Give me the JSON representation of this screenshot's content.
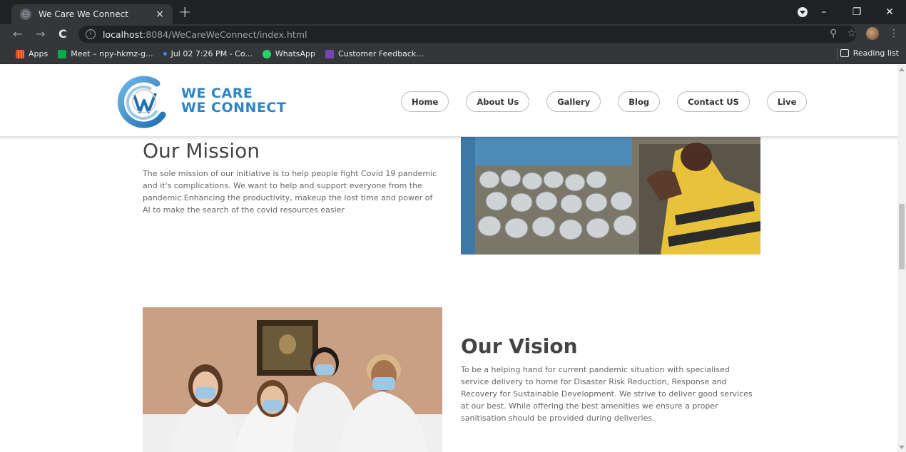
{
  "browser": {
    "tab_title": "We Care We Connect",
    "tab_close": "×",
    "new_tab": "+",
    "url_host": "localhost",
    "url_rest": ":8084/WeCareWeConnect/index.html",
    "window_min": "–",
    "window_restore": "❐",
    "window_close": "✕"
  },
  "bookmarks": [
    {
      "label": "Apps",
      "icon": "apps-grid-icon",
      "color": "#4285f4"
    },
    {
      "label": "Meet – npy-hkmz-g...",
      "icon": "meet-icon",
      "color": "#00ac47"
    },
    {
      "label": "Jul 02 7:26 PM - Co...",
      "icon": "dot-icon",
      "color": "#4285f4"
    },
    {
      "label": "WhatsApp",
      "icon": "whatsapp-icon",
      "color": "#25d366"
    },
    {
      "label": "Customer Feedback...",
      "icon": "forms-icon",
      "color": "#7248b9"
    }
  ],
  "reading_list": "Reading list",
  "site": {
    "brand_line1": "WE CARE",
    "brand_line2": "WE CONNECT",
    "nav": [
      "Home",
      "About Us",
      "Gallery",
      "Blog",
      "Contact US",
      "Live"
    ],
    "accent": "#2f84c6"
  },
  "mission": {
    "title": "Our Mission",
    "text": "The sole mission of our initiative is to help people fight Covid 19 pandemic and it's complications. We want to help and support everyone from the pandemic.Enhancing the productivity, makeup the lost time and power of AI to make the search of the covid resources easier"
  },
  "vision": {
    "title": "Our Vision",
    "text": "To be a helping hand for current pandemic situation with specialised service delivery to home for Disaster Risk Reduction, Response and Recovery for Sustainable Development. We strive to deliver good services at our best. While offering the best amenities we ensure a proper sanitisation should be provided during deliveries."
  }
}
